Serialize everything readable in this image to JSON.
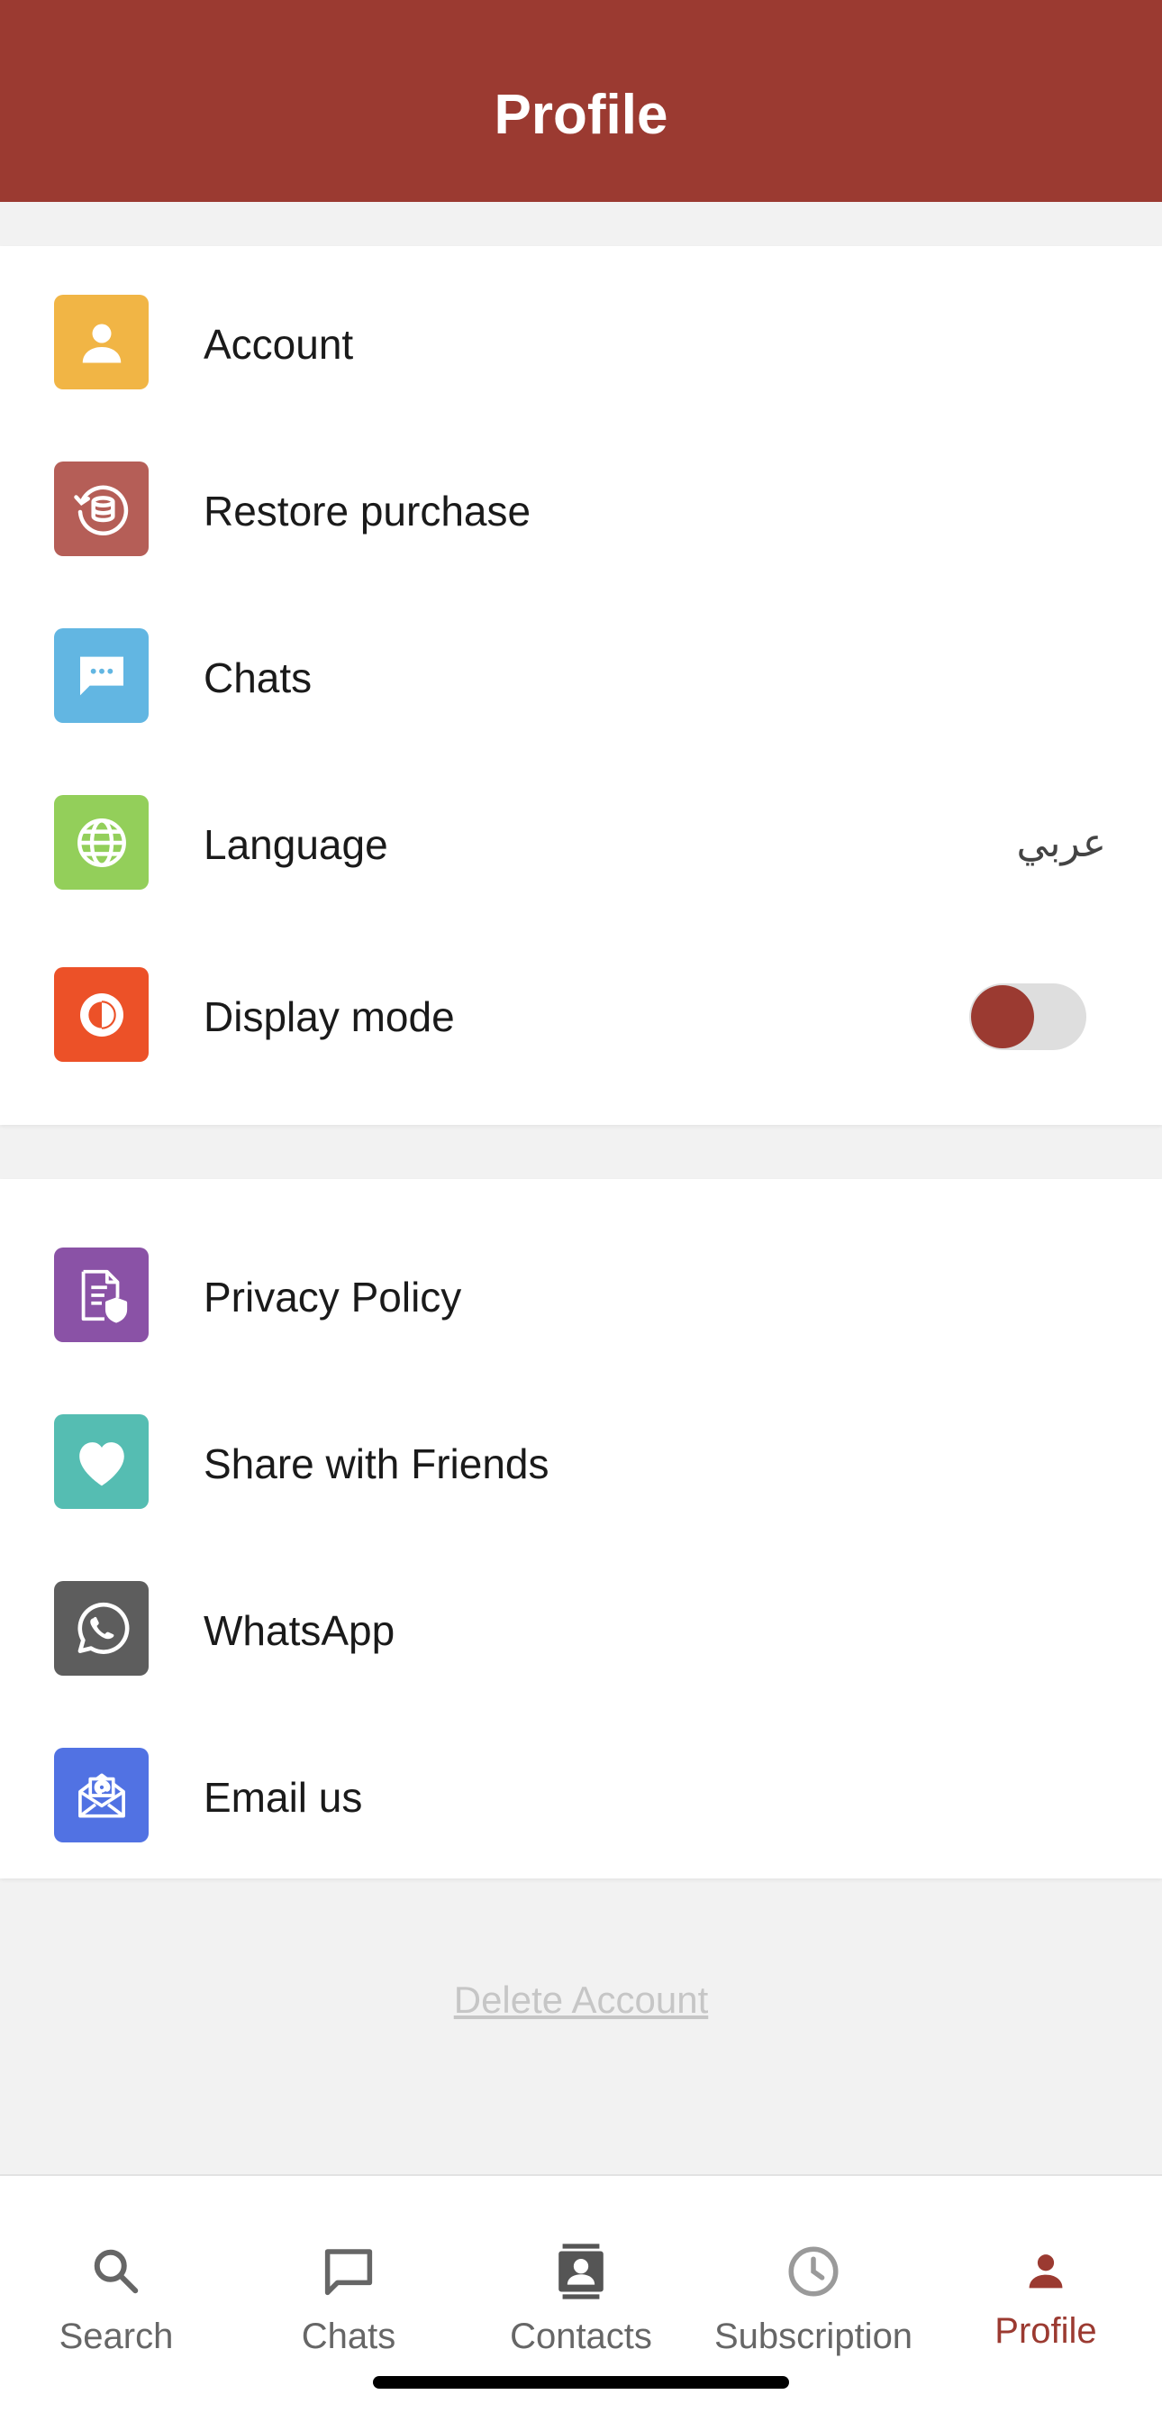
{
  "header": {
    "title": "Profile"
  },
  "colors": {
    "brand": "#9b3a31",
    "account_icon": "#f1b545",
    "restore_icon": "#b55e57",
    "chats_icon": "#62b6e2",
    "language_icon": "#93cf5a",
    "display_icon": "#ec5128",
    "privacy_icon": "#8a52a6",
    "share_icon": "#55bdb2",
    "whatsapp_icon": "#5d5d5d",
    "email_icon": "#5172e3"
  },
  "settings": {
    "account": {
      "label": "Account",
      "icon": "person-icon"
    },
    "restore": {
      "label": "Restore purchase",
      "icon": "restore-coins-icon"
    },
    "chats": {
      "label": "Chats",
      "icon": "chat-bubble-icon"
    },
    "language": {
      "label": "Language",
      "value": "عربي",
      "icon": "globe-icon"
    },
    "display": {
      "label": "Display mode",
      "icon": "contrast-icon",
      "toggle_on": false
    }
  },
  "support": {
    "privacy": {
      "label": "Privacy Policy",
      "icon": "document-shield-icon"
    },
    "share": {
      "label": "Share with Friends",
      "icon": "heart-icon"
    },
    "whatsapp": {
      "label": "WhatsApp",
      "icon": "whatsapp-icon"
    },
    "email": {
      "label": "Email us",
      "icon": "envelope-icon"
    }
  },
  "delete_account": "Delete Account",
  "tabs": {
    "search": {
      "label": "Search",
      "icon": "search-icon"
    },
    "chats": {
      "label": "Chats",
      "icon": "chat-icon"
    },
    "contacts": {
      "label": "Contacts",
      "icon": "contacts-icon"
    },
    "subscription": {
      "label": "Subscription",
      "icon": "clock-icon"
    },
    "profile": {
      "label": "Profile",
      "icon": "person-icon",
      "active": true
    }
  }
}
